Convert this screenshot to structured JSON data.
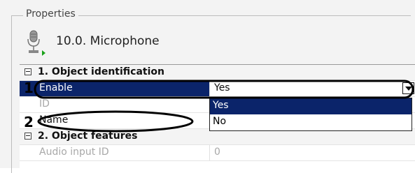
{
  "group": {
    "title": "Properties"
  },
  "device": {
    "title": "10.0. Microphone",
    "icon": "microphone-icon"
  },
  "sections": [
    {
      "label": "1. Object identification"
    },
    {
      "label": "2. Object features"
    }
  ],
  "properties": {
    "enable": {
      "label": "Enable",
      "value": "Yes"
    },
    "id": {
      "label": "ID",
      "value": ""
    },
    "name": {
      "label": "Name",
      "value": ""
    },
    "audio_input_id": {
      "label": "Audio input ID",
      "value": "0"
    }
  },
  "dropdown": {
    "options": [
      "Yes",
      "No"
    ],
    "selected": "Yes"
  },
  "annotations": [
    "1",
    "2"
  ],
  "colors": {
    "selection": "#0b246a"
  }
}
